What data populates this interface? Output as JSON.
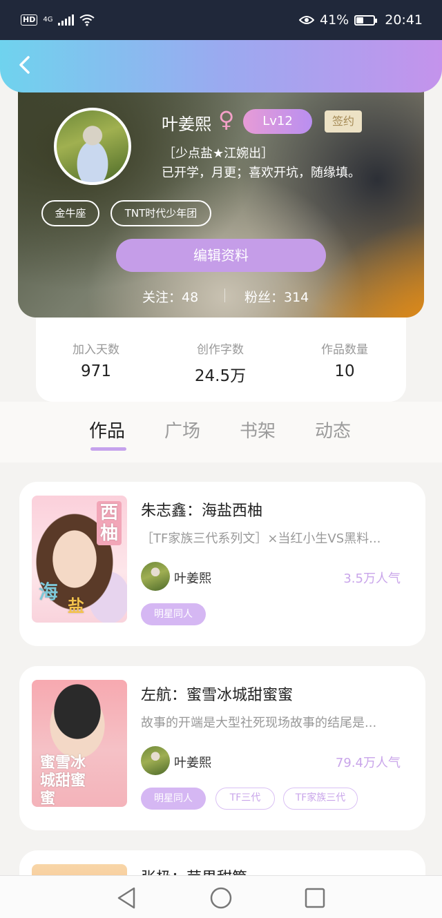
{
  "status_bar": {
    "hd": "HD",
    "network": "4G",
    "battery_percent": "41%",
    "battery_level": 0.41,
    "time": "20:41",
    "icons": [
      "hd-icon",
      "signal-icon",
      "wifi-icon",
      "eye-comfort-icon",
      "battery-icon"
    ]
  },
  "header": {
    "back_icon": "back-arrow-icon"
  },
  "profile": {
    "name": "叶姜熙",
    "gender_symbol": "♀",
    "level": "Lv12",
    "signed": "签约",
    "bio_line1": "［少点盐★江婉出］",
    "bio_line2": "已开学，月更；喜欢开坑，随缘填。",
    "tags": [
      "金牛座",
      "TNT时代少年团"
    ],
    "edit_button": "编辑资料",
    "following": "关注：48",
    "fans": "粉丝：314"
  },
  "stats": [
    {
      "label": "加入天数",
      "value": "971"
    },
    {
      "label": "创作字数",
      "value": "24.5万"
    },
    {
      "label": "作品数量",
      "value": "10"
    }
  ],
  "tabs": [
    "作品",
    "广场",
    "书架",
    "动态"
  ],
  "active_tab": "作品",
  "works": [
    {
      "title": "朱志鑫：海盐西柚",
      "description": "［TF家族三代系列文］×当红小生VS黑料...",
      "author": "叶姜熙",
      "popularity": "3.5万人气",
      "tags": [
        "明星同人"
      ],
      "cover_text": [
        "西柚",
        "海",
        "盐"
      ]
    },
    {
      "title": "左航：蜜雪冰城甜蜜蜜",
      "description": "故事的开端是大型社死现场故事的结尾是...",
      "author": "叶姜熙",
      "popularity": "79.4万人气",
      "tags": [
        "明星同人",
        "TF三代",
        "TF家族三代"
      ],
      "cover_text": [
        "蜜雪冰城甜蜜蜜"
      ]
    },
    {
      "title": "张极：苹果甜筒"
    }
  ],
  "nav": {
    "back_icon": "nav-back-icon",
    "home_icon": "nav-home-icon",
    "recent_icon": "nav-recent-icon"
  },
  "colors": {
    "accent_purple": "#c59de8",
    "header_gradient_start": "#6fd3ee",
    "header_gradient_end": "#c493ec",
    "popularity_text": "#c9a5ea"
  }
}
